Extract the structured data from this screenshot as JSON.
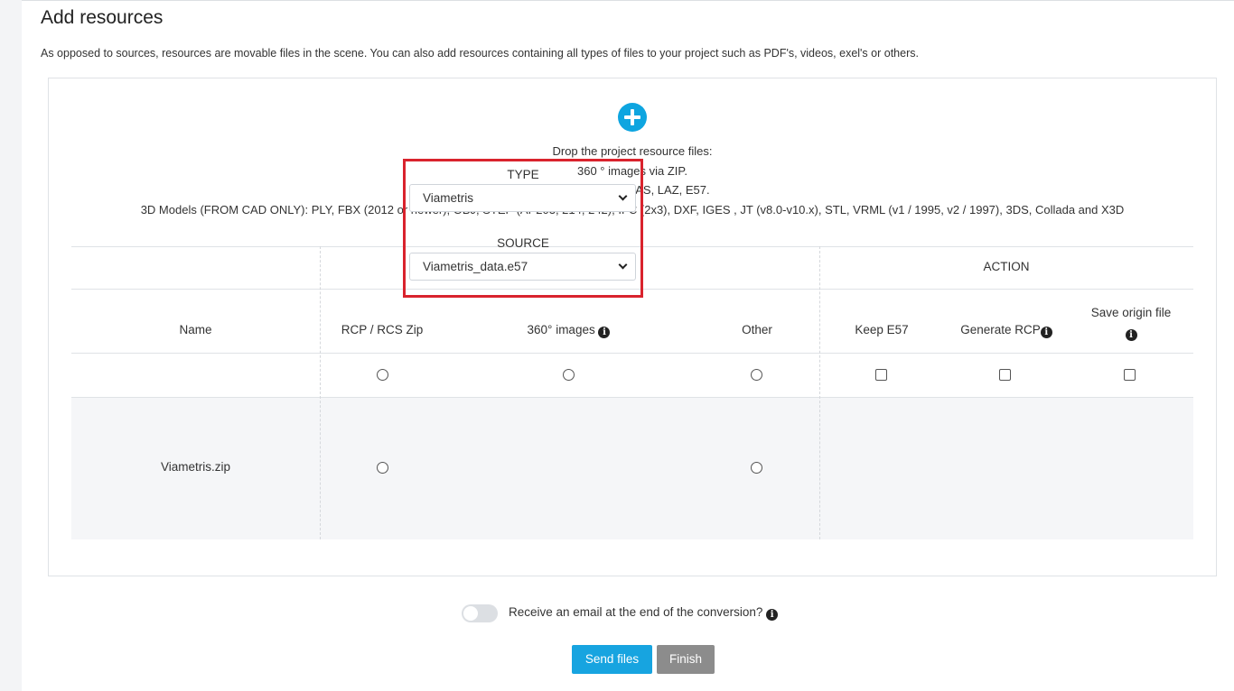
{
  "page": {
    "title": "Add resources",
    "intro": "As opposed to sources, resources are movable files in the scene. You can also add resources containing all types of files to your project such as PDF's, videos, exel's or others."
  },
  "dropzone": {
    "lines": [
      "Drop the project resource files:",
      "360 ° images via ZIP.",
      "Point clouds : LAS, LAZ, E57.",
      "3D Models (FROM CAD ONLY): PLY, FBX (2012 or newer), OBJ, STEP (AP203, 214, 242), IFC (2x3), DXF, IGES , JT (v8.0-v10.x), STL, VRML (v1 / 1995, v2 / 1997), 3DS, Collada and X3D"
    ],
    "icon": "plus-circle-icon",
    "icon_color": "#0ea5e0"
  },
  "table": {
    "group_headers": {
      "type": "TYPE",
      "action": "ACTION"
    },
    "columns": {
      "name": "Name",
      "rcp": "RCP / RCS Zip",
      "images360": "360° images",
      "other": "Other",
      "keep_e57": "Keep E57",
      "generate_rcp": "Generate RCP",
      "save_origin": "Save origin file"
    },
    "info_glyph": "i",
    "file_row": {
      "name": "Viametris.zip",
      "type_label": "TYPE",
      "type_value": "Viametris",
      "source_label": "SOURCE",
      "source_value": "Viametris_data.e57"
    }
  },
  "highlight_color": "#d9232d",
  "email_toggle": {
    "label": "Receive an email at the end of the conversion?",
    "on": false
  },
  "buttons": {
    "send": "Send files",
    "finish": "Finish"
  },
  "colors": {
    "accent": "#17a4e0",
    "disabled": "#8c8c8c"
  }
}
